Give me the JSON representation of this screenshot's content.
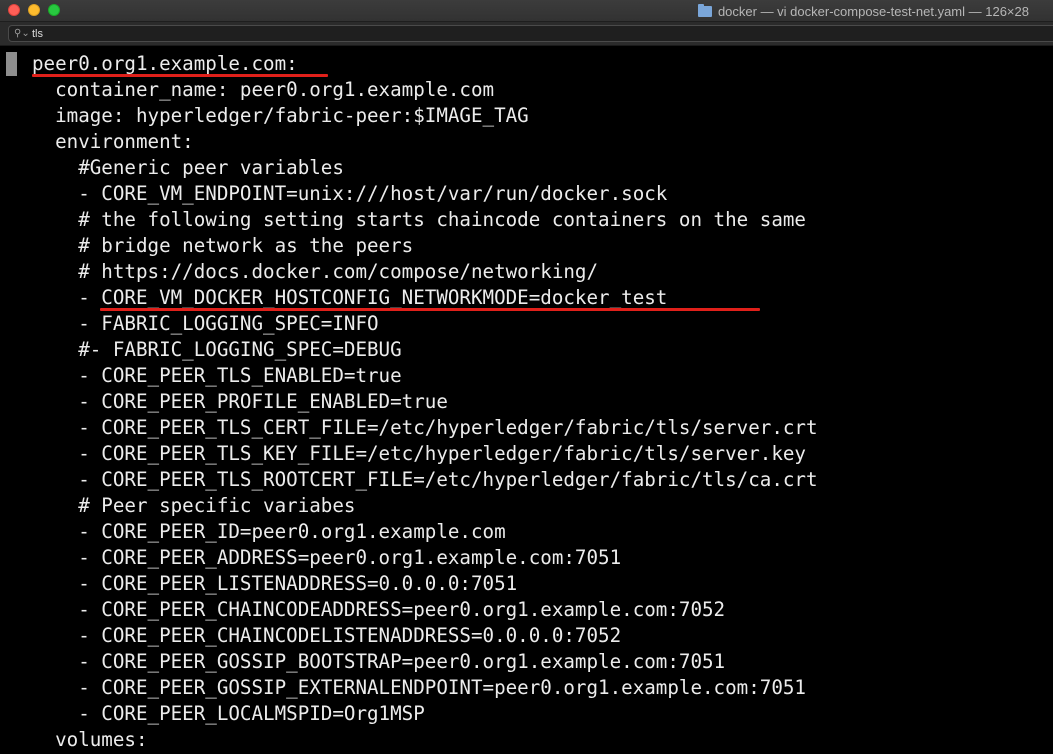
{
  "window": {
    "title": "docker — vi docker-compose-test-net.yaml — 126×28",
    "folder_icon": "folder-icon"
  },
  "find": {
    "icon": "search-icon",
    "query": "tls"
  },
  "terminal": {
    "annotation_color": "#e0201a",
    "lines": [
      "peer0.org1.example.com:",
      "  container_name: peer0.org1.example.com",
      "  image: hyperledger/fabric-peer:$IMAGE_TAG",
      "  environment:",
      "    #Generic peer variables",
      "    - CORE_VM_ENDPOINT=unix:///host/var/run/docker.sock",
      "    # the following setting starts chaincode containers on the same",
      "    # bridge network as the peers",
      "    # https://docs.docker.com/compose/networking/",
      "    - CORE_VM_DOCKER_HOSTCONFIG_NETWORKMODE=docker_test",
      "    - FABRIC_LOGGING_SPEC=INFO",
      "    #- FABRIC_LOGGING_SPEC=DEBUG",
      "    - CORE_PEER_TLS_ENABLED=true",
      "    - CORE_PEER_PROFILE_ENABLED=true",
      "    - CORE_PEER_TLS_CERT_FILE=/etc/hyperledger/fabric/tls/server.crt",
      "    - CORE_PEER_TLS_KEY_FILE=/etc/hyperledger/fabric/tls/server.key",
      "    - CORE_PEER_TLS_ROOTCERT_FILE=/etc/hyperledger/fabric/tls/ca.crt",
      "    # Peer specific variabes",
      "    - CORE_PEER_ID=peer0.org1.example.com",
      "    - CORE_PEER_ADDRESS=peer0.org1.example.com:7051",
      "    - CORE_PEER_LISTENADDRESS=0.0.0.0:7051",
      "    - CORE_PEER_CHAINCODEADDRESS=peer0.org1.example.com:7052",
      "    - CORE_PEER_CHAINCODELISTENADDRESS=0.0.0.0:7052",
      "    - CORE_PEER_GOSSIP_BOOTSTRAP=peer0.org1.example.com:7051",
      "    - CORE_PEER_GOSSIP_EXTERNALENDPOINT=peer0.org1.example.com:7051",
      "    - CORE_PEER_LOCALMSPID=Org1MSP",
      "  volumes:"
    ]
  }
}
